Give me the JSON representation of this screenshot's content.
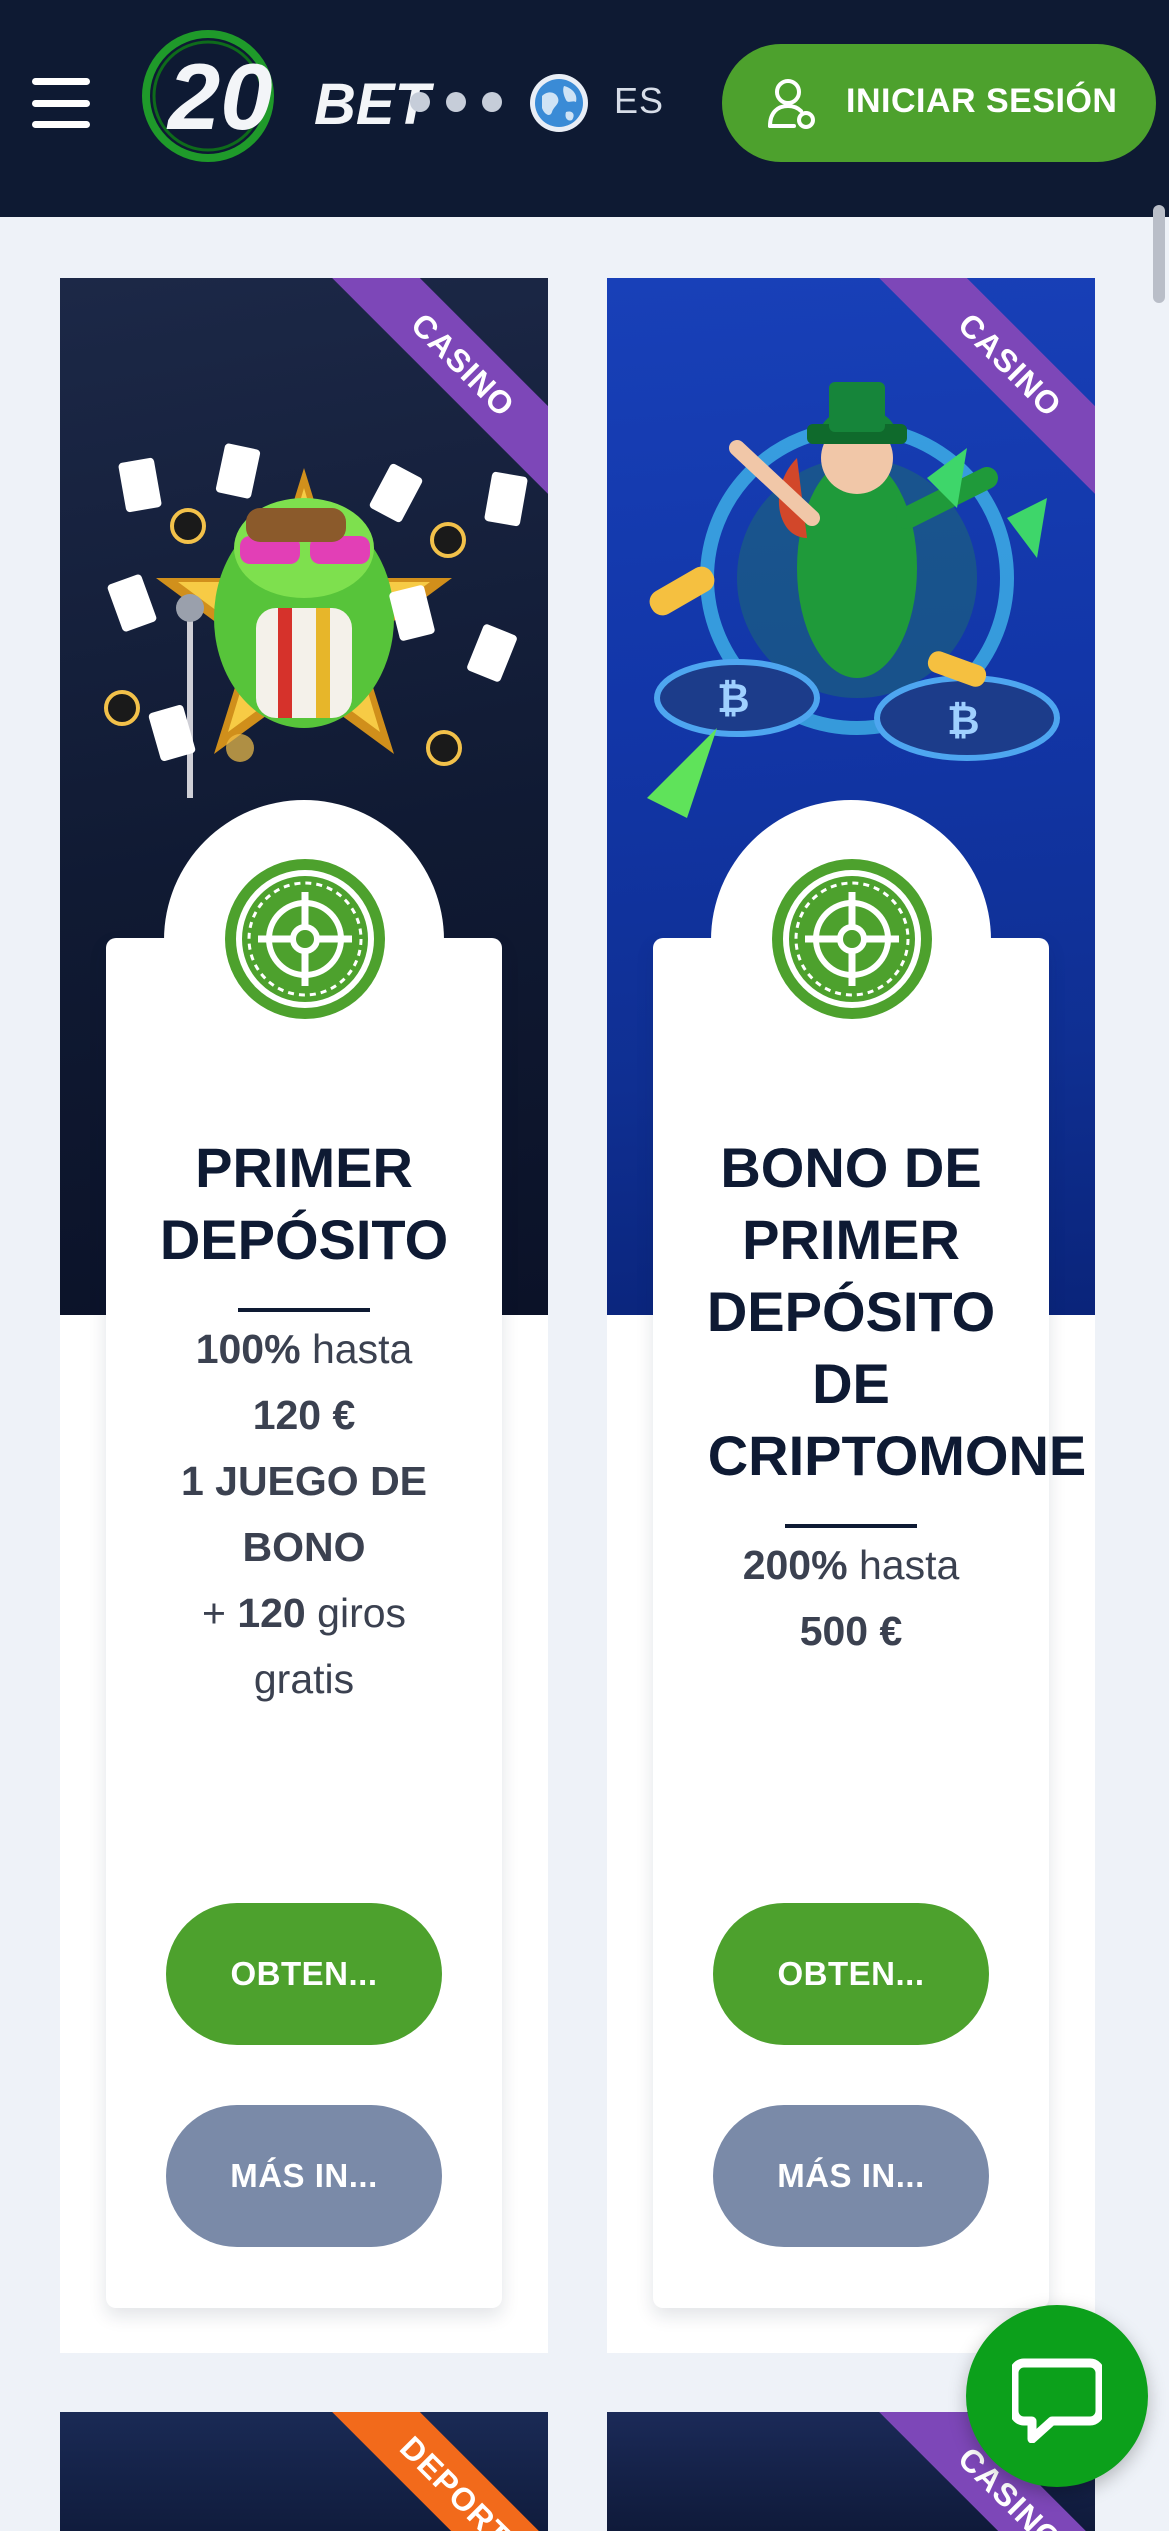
{
  "header": {
    "menu_icon": "hamburger-menu-icon",
    "logo_text": "20BET",
    "language": "ES",
    "language_icon": "globe-icon",
    "login_label": "INICIAR SESIÓN",
    "login_icon": "user-icon",
    "colors": {
      "header_bg": "#0e1a33",
      "accent_green": "#4da12d"
    }
  },
  "promotions": [
    {
      "tag": "CASINO",
      "tag_color": "#7d47b8",
      "icon": "roulette-icon",
      "title_lines": [
        "PRIMER",
        "DEPÓSITO"
      ],
      "offer": {
        "percent": "100%",
        "upto": "hasta",
        "amount": "120 €",
        "bonus_game": "1 JUEGO DE",
        "bonus_game_2": "BONO",
        "plus": "+",
        "spins_count": "120",
        "spins_label": "giros",
        "spins_label_2": "gratis"
      },
      "primary_button": "OBTEN...",
      "secondary_button": "MÁS IN..."
    },
    {
      "tag": "CASINO",
      "tag_color": "#7d47b8",
      "icon": "roulette-icon",
      "title_lines": [
        "BONO DE",
        "PRIMER",
        "DEPÓSITO",
        "DE",
        "CRIPTOMONE"
      ],
      "offer": {
        "percent": "200%",
        "upto": "hasta",
        "amount": "500 €"
      },
      "primary_button": "OBTEN...",
      "secondary_button": "MÁS IN..."
    }
  ],
  "next_row": [
    {
      "tag": "DEPORTE",
      "tag_color": "#f26a1b"
    },
    {
      "tag": "CASINO",
      "tag_color": "#7d47b8"
    }
  ],
  "chat": {
    "icon": "chat-bubble-icon",
    "color": "#0ca01b"
  }
}
